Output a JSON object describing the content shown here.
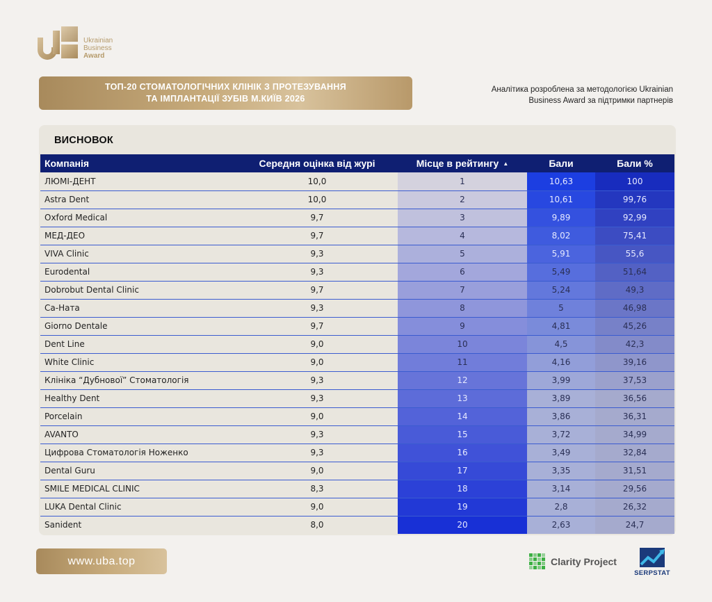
{
  "brand": {
    "logo_line1": "Ukrainian",
    "logo_line2": "Business",
    "logo_line3": "Award",
    "gold": "#b59a6a"
  },
  "header": {
    "title_line1": "ТОП-20 СТОМАТОЛОГІЧНИХ КЛІНІК З ПРОТЕЗУВАННЯ",
    "title_line2": "ТА ІМПЛАНТАЦІЇ ЗУБІВ М.КИЇВ 2026",
    "analytics_line1": "Аналітика розроблена за методологією Ukrainian",
    "analytics_line2": "Business Award за підтримки партнерів"
  },
  "section": {
    "title": "ВИСНОВОК"
  },
  "table": {
    "columns": [
      "Компанія",
      "Середня оцінка від журі",
      "Місце в рейтингу",
      "Бали",
      "Бали %"
    ],
    "sort_icon": "sort-ascending-icon",
    "rows": [
      {
        "company": "ЛЮМІ-ДЕНТ",
        "jury": "10,0",
        "place": "1",
        "score": "10,63",
        "pct": "100"
      },
      {
        "company": "Astra Dent",
        "jury": "10,0",
        "place": "2",
        "score": "10,61",
        "pct": "99,76"
      },
      {
        "company": "Oxford Medical",
        "jury": "9,7",
        "place": "3",
        "score": "9,89",
        "pct": "92,99"
      },
      {
        "company": "МЕД-ДЕО",
        "jury": "9,7",
        "place": "4",
        "score": "8,02",
        "pct": "75,41"
      },
      {
        "company": "VIVA Clinic",
        "jury": "9,3",
        "place": "5",
        "score": "5,91",
        "pct": "55,6"
      },
      {
        "company": "Eurodental",
        "jury": "9,3",
        "place": "6",
        "score": "5,49",
        "pct": "51,64"
      },
      {
        "company": "Dobrobut Dental Clinic",
        "jury": "9,7",
        "place": "7",
        "score": "5,24",
        "pct": "49,3"
      },
      {
        "company": "Са-Ната",
        "jury": "9,3",
        "place": "8",
        "score": "5",
        "pct": "46,98"
      },
      {
        "company": "Giorno Dentale",
        "jury": "9,7",
        "place": "9",
        "score": "4,81",
        "pct": "45,26"
      },
      {
        "company": "Dent Line",
        "jury": "9,0",
        "place": "10",
        "score": "4,5",
        "pct": "42,3"
      },
      {
        "company": "White Clinic",
        "jury": "9,0",
        "place": "11",
        "score": "4,16",
        "pct": "39,16"
      },
      {
        "company": "Клініка “Дубнової” Стоматологія",
        "jury": "9,3",
        "place": "12",
        "score": "3,99",
        "pct": "37,53"
      },
      {
        "company": "Healthy Dent",
        "jury": "9,3",
        "place": "13",
        "score": "3,89",
        "pct": "36,56"
      },
      {
        "company": "Porcelain",
        "jury": "9,0",
        "place": "14",
        "score": "3,86",
        "pct": "36,31"
      },
      {
        "company": "AVANTO",
        "jury": "9,3",
        "place": "15",
        "score": "3,72",
        "pct": "34,99"
      },
      {
        "company": "Цифрова Стоматологія Ноженко",
        "jury": "9,3",
        "place": "16",
        "score": "3,49",
        "pct": "32,84"
      },
      {
        "company": "Dental Guru",
        "jury": "9,0",
        "place": "17",
        "score": "3,35",
        "pct": "31,51"
      },
      {
        "company": "SMILE MEDICAL CLINIC",
        "jury": "8,3",
        "place": "18",
        "score": "3,14",
        "pct": "29,56"
      },
      {
        "company": "LUKA Dental Clinic",
        "jury": "9,0",
        "place": "19",
        "score": "2,8",
        "pct": "26,32"
      },
      {
        "company": "Sanident",
        "jury": "8,0",
        "place": "20",
        "score": "2,63",
        "pct": "24,7"
      }
    ]
  },
  "footer": {
    "url": "www.uba.top",
    "partner1": "Clarity Project",
    "partner2": "SERPSTAT"
  }
}
